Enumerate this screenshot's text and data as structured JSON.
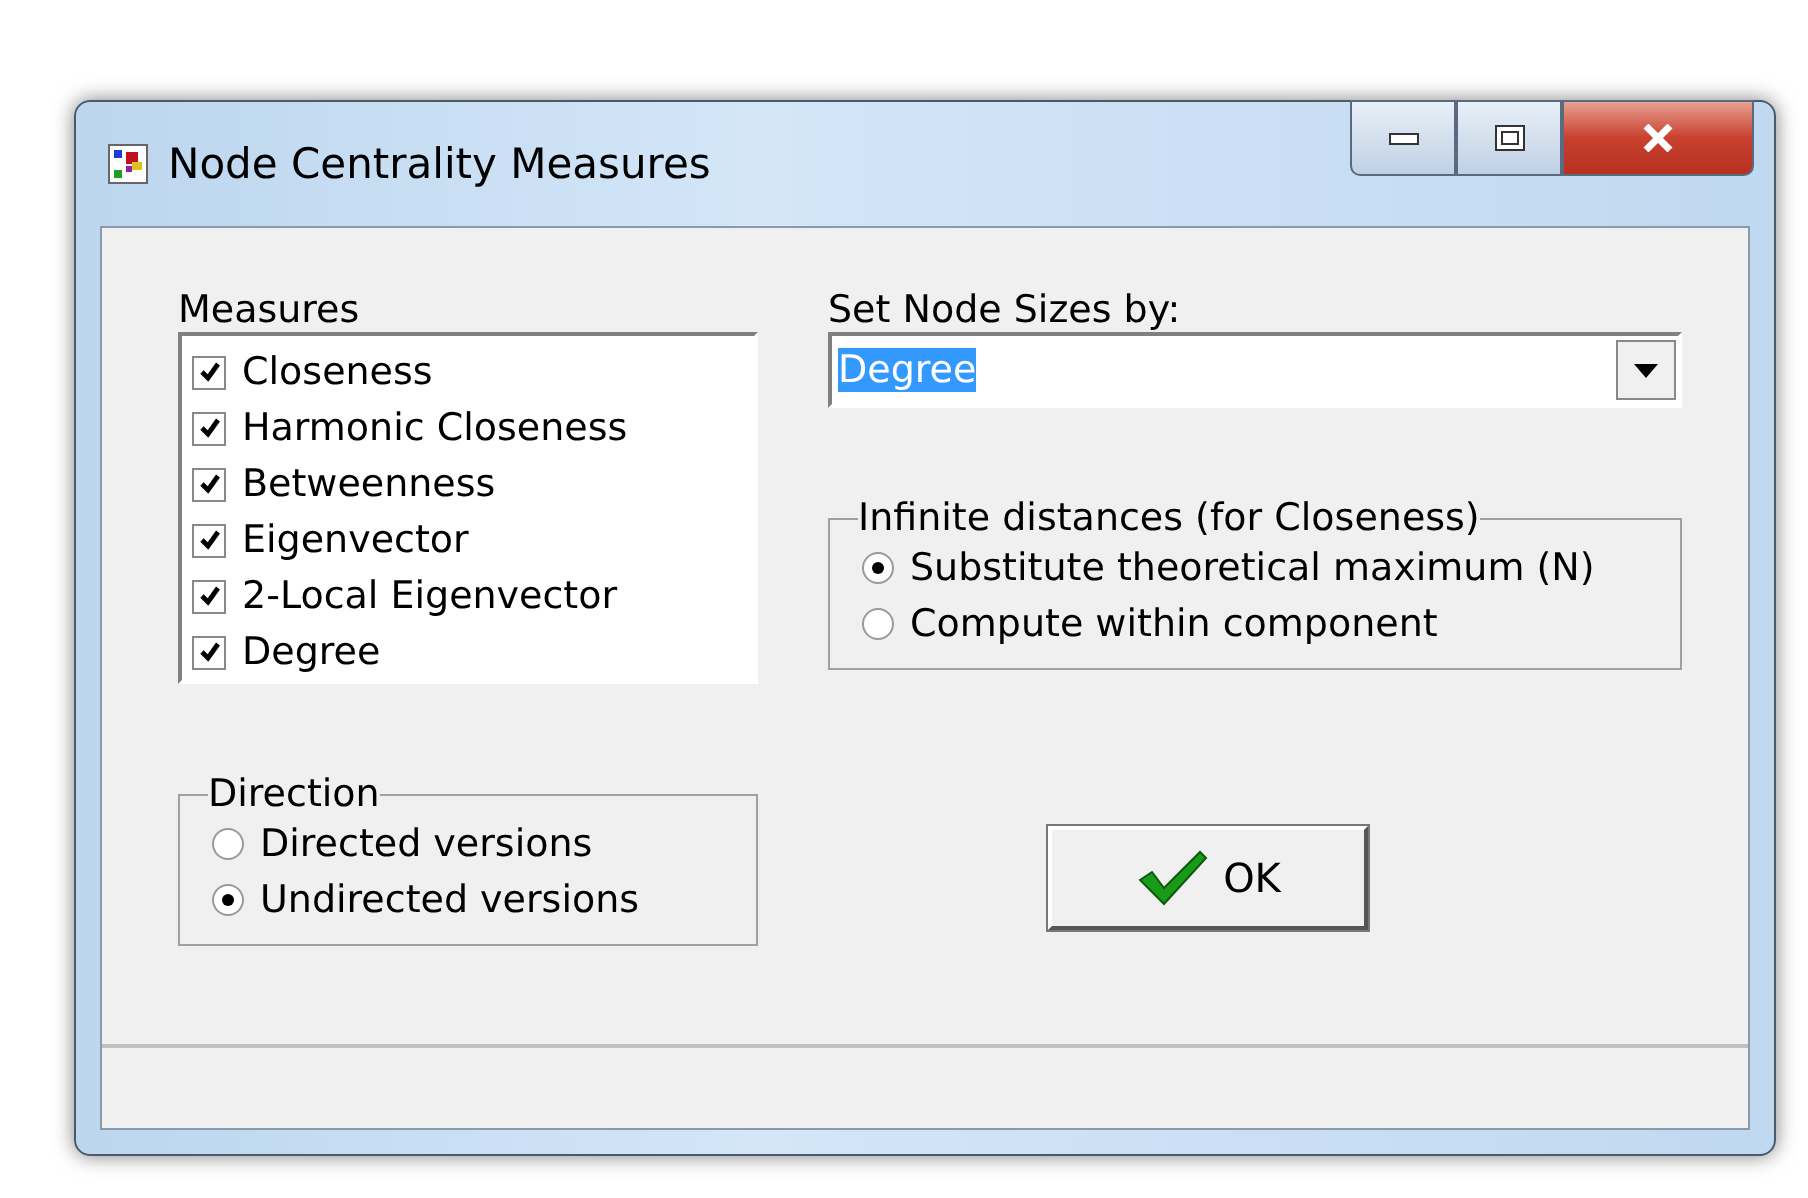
{
  "window": {
    "title": "Node Centrality Measures"
  },
  "measures": {
    "label": "Measures",
    "items": [
      {
        "label": "Closeness",
        "checked": true
      },
      {
        "label": "Harmonic Closeness",
        "checked": true
      },
      {
        "label": "Betweenness",
        "checked": true
      },
      {
        "label": "Eigenvector",
        "checked": true
      },
      {
        "label": "2-Local Eigenvector",
        "checked": true
      },
      {
        "label": "Degree",
        "checked": true
      }
    ]
  },
  "node_sizes": {
    "label": "Set Node Sizes by:",
    "value": "Degree"
  },
  "infinite_distances": {
    "label": "Infinite distances (for Closeness)",
    "options": [
      {
        "label": "Substitute theoretical maximum (N)",
        "selected": true
      },
      {
        "label": "Compute within component",
        "selected": false
      }
    ]
  },
  "direction": {
    "label": "Direction",
    "options": [
      {
        "label": "Directed versions",
        "selected": false
      },
      {
        "label": "Undirected versions",
        "selected": true
      }
    ]
  },
  "ok_button": {
    "label": "OK"
  }
}
